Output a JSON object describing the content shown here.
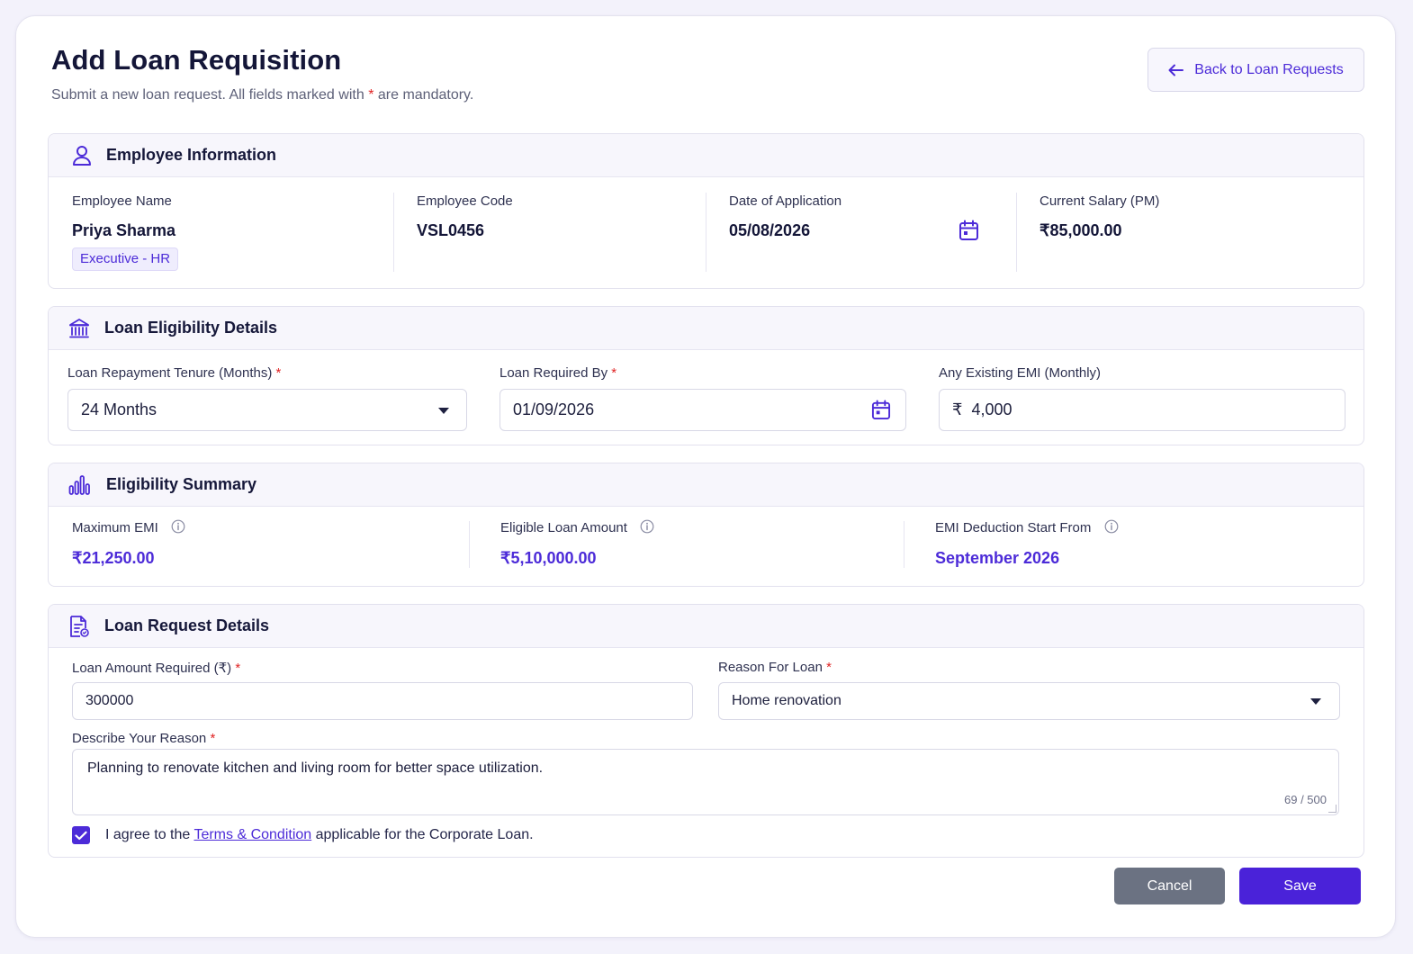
{
  "header": {
    "title": "Add Loan Requisition",
    "subtitle_pre": "Submit a new loan request. All fields marked with",
    "subtitle_star": "*",
    "subtitle_post": "are mandatory.",
    "back_label": "Back to Loan Requests"
  },
  "employee": {
    "section_title": "Employee Information",
    "name_label": "Employee Name",
    "name": "Priya Sharma",
    "designation": "Executive - HR",
    "code_label": "Employee Code",
    "code": "VSL0456",
    "date_label": "Date of Application",
    "date": "05/08/2026",
    "salary_label": "Current Salary (PM)",
    "salary": "₹85,000.00"
  },
  "eligibility": {
    "section_title": "Loan Eligibility Details",
    "tenure_label": "Loan Repayment Tenure (Months)",
    "tenure_value": "24 Months",
    "required_by_label": "Loan Required By",
    "required_by_value": "01/09/2026",
    "existing_emi_label": "Any Existing EMI (Monthly)",
    "currency_symbol": "₹",
    "existing_emi_value": "4,000"
  },
  "summary": {
    "section_title": "Eligibility Summary",
    "max_emi_label": "Maximum EMI",
    "max_emi": "₹21,250.00",
    "eligible_label": "Eligible Loan Amount",
    "eligible": "₹5,10,000.00",
    "start_label": "EMI Deduction Start From",
    "start": "September 2026"
  },
  "request": {
    "section_title": "Loan Request Details",
    "amount_label": "Loan Amount Required (₹)",
    "amount_value": "300000",
    "reason_label": "Reason For Loan",
    "reason_value": "Home renovation",
    "describe_label": "Describe Your Reason",
    "describe_value": "Planning to renovate kitchen and living room for better space utilization.",
    "char_count": "69 / 500",
    "agree_pre": "I agree to the",
    "agree_link": "Terms & Condition",
    "agree_post": "applicable for the Corporate Loan.",
    "agree_checked": true
  },
  "actions": {
    "cancel_label": "Cancel",
    "save_label": "Save"
  },
  "theme": {
    "accent": "#4c2bd8",
    "required_star": "#e02424",
    "cancel_bg": "#6b7282"
  },
  "icons": {
    "back": "arrow-left-icon",
    "employee": "user-icon",
    "eligibility": "bank-icon",
    "summary": "bar-chart-icon",
    "request": "document-icon",
    "calendar": "calendar-icon",
    "info": "info-icon",
    "dropdown": "chevron-down-icon",
    "check": "check-icon"
  }
}
